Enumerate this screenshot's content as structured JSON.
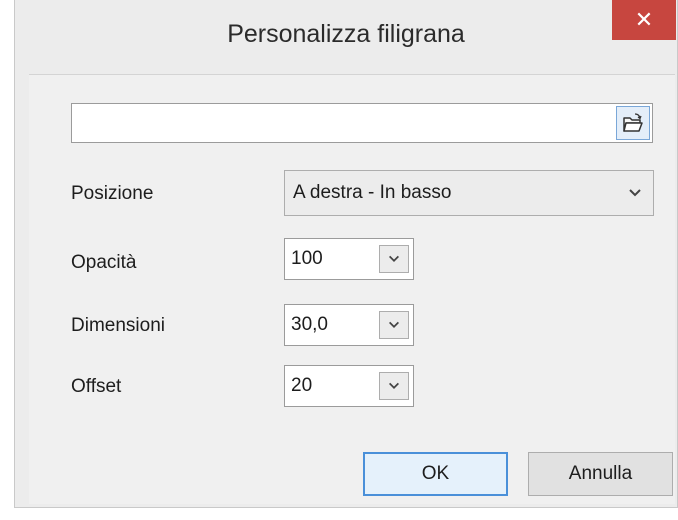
{
  "window": {
    "title": "Personalizza filigrana",
    "close_label": "✕"
  },
  "file": {
    "path": ""
  },
  "position": {
    "label": "Posizione",
    "value": "A destra - In basso"
  },
  "opacity": {
    "label": "Opacità",
    "value": "100"
  },
  "size": {
    "label": "Dimensioni",
    "value": "30,0"
  },
  "offset": {
    "label": "Offset",
    "value": "20"
  },
  "buttons": {
    "ok": "OK",
    "cancel": "Annulla"
  }
}
